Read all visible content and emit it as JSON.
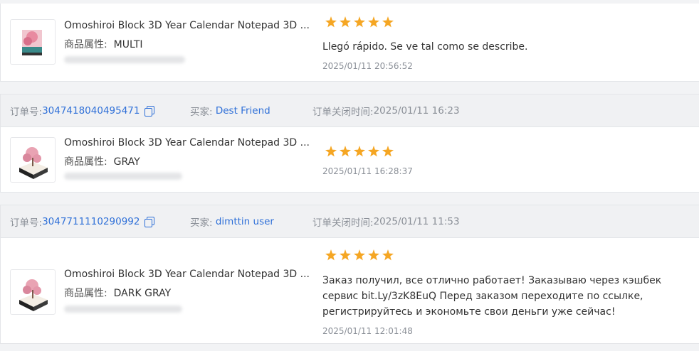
{
  "labels": {
    "order_no": "订单号:",
    "buyer": "买家:",
    "close_time": "订单关闭时间:",
    "attr": "商品属性:"
  },
  "cards": [
    {
      "product_title": "Omoshiroi Block 3D Year Calendar Notepad 3D ...",
      "attr_value": "MULTI",
      "stars": 5,
      "review_text": "Llegó rápido. Se ve tal como se describe.",
      "review_time": "2025/01/11 20:56:52"
    },
    {
      "order_no": "3047418040495471",
      "buyer": "Dest Friend",
      "close_time": "2025/01/11 16:23",
      "product_title": "Omoshiroi Block 3D Year Calendar Notepad 3D ...",
      "attr_value": "GRAY",
      "stars": 5,
      "review_text": "",
      "review_time": "2025/01/11 16:28:37"
    },
    {
      "order_no": "3047711110290992",
      "buyer": "dimttin user",
      "close_time": "2025/01/11 11:53",
      "product_title": "Omoshiroi Block 3D Year Calendar Notepad 3D ...",
      "attr_value": "DARK GRAY",
      "stars": 5,
      "review_text": "Заказ получил, все отлично работает! Заказываю через кэшбек сервис bit.Ly/3zK8EuQ Перед заказом переходите по ссылке, регистрируйтесь и экономьте свои деньги уже сейчас!",
      "review_time": "2025/01/11 12:01:48"
    }
  ],
  "colors": {
    "link": "#2f70d8",
    "star": "#f5a623",
    "header_bg": "#f0f1f3"
  }
}
